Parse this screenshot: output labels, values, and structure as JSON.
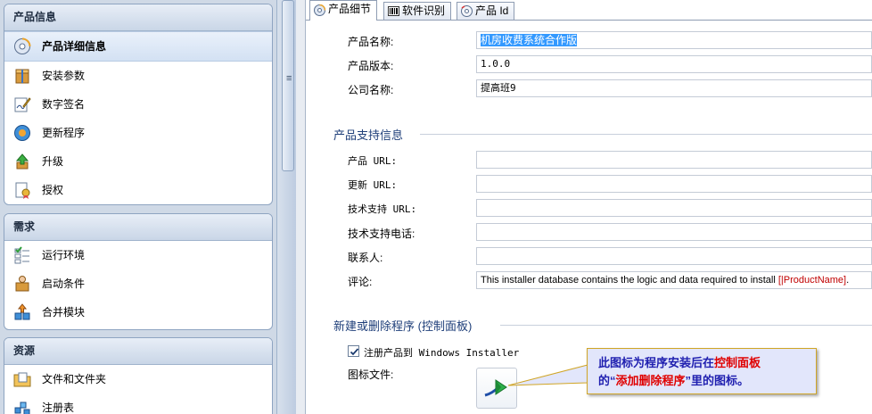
{
  "sidebar": {
    "groups": [
      {
        "title": "产品信息",
        "items": [
          {
            "label": "产品详细信息",
            "icon": "product-details-icon",
            "selected": true
          },
          {
            "label": "安装参数",
            "icon": "install-params-icon"
          },
          {
            "label": "数字签名",
            "icon": "digital-signature-icon"
          },
          {
            "label": "更新程序",
            "icon": "update-icon"
          },
          {
            "label": "升级",
            "icon": "upgrade-icon"
          },
          {
            "label": "授权",
            "icon": "license-icon"
          }
        ]
      },
      {
        "title": "需求",
        "items": [
          {
            "label": "运行环境",
            "icon": "runtime-env-icon"
          },
          {
            "label": "启动条件",
            "icon": "launch-condition-icon"
          },
          {
            "label": "合并模块",
            "icon": "merge-module-icon"
          }
        ]
      },
      {
        "title": "资源",
        "items": [
          {
            "label": "文件和文件夹",
            "icon": "files-folders-icon"
          },
          {
            "label": "注册表",
            "icon": "registry-icon"
          }
        ]
      }
    ]
  },
  "tabs": [
    {
      "label": "产品细节",
      "icon": "cd-icon",
      "active": true
    },
    {
      "label": "软件识别",
      "icon": "barcode-icon"
    },
    {
      "label": "产品 Id",
      "icon": "cd-id-icon"
    }
  ],
  "product": {
    "name_label": "产品名称:",
    "name_value": "机房收费系统合作版",
    "version_label": "产品版本:",
    "version_value": "1.0.0",
    "company_label": "公司名称:",
    "company_value": "提高班9"
  },
  "support": {
    "section_title": "产品支持信息",
    "product_url_label": "产品 URL:",
    "update_url_label": "更新 URL:",
    "tech_url_label": "技术支持 URL:",
    "tech_phone_label": "技术支持电话:",
    "contact_label": "联系人:",
    "comment_label": "评论:",
    "comment_prefix": "This installer database contains the logic and data required to install ",
    "comment_token": "[|ProductName]",
    "comment_suffix": "."
  },
  "addremove": {
    "section_title": "新建或删除程序 (控制面板)",
    "register_label": "注册产品到 Windows Installer",
    "register_checked": true,
    "icon_file_label": "图标文件:"
  },
  "callout": {
    "line1_a": "此图标为程序安装后在",
    "line1_b": "控制面板",
    "line2_a": "的“",
    "line2_b": "添加删除程序",
    "line2_c": "”里的图标。"
  }
}
